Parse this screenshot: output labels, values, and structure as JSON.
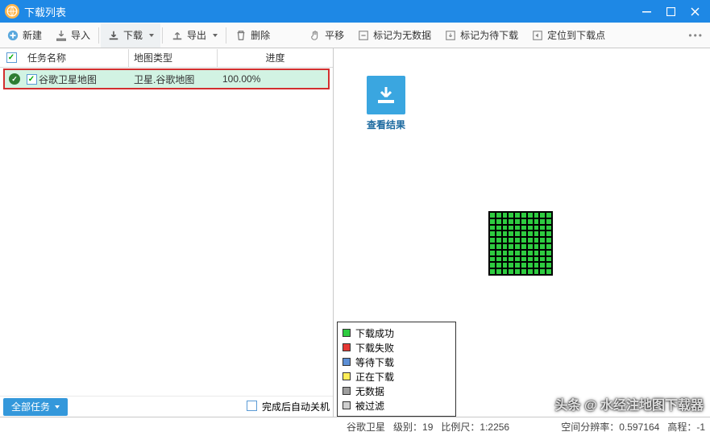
{
  "window": {
    "title": "下载列表"
  },
  "toolbar_left": {
    "new": "新建",
    "import": "导入",
    "download": "下载",
    "export": "导出",
    "delete": "删除"
  },
  "toolbar_right": {
    "pan": "平移",
    "mark_nodata": "标记为无数据",
    "mark_todl": "标记为待下载",
    "locate": "定位到下载点"
  },
  "columns": {
    "name": "任务名称",
    "type": "地图类型",
    "progress": "进度"
  },
  "tasks": [
    {
      "name": "谷歌卫星地图",
      "type": "卫星.谷歌地图",
      "progress": "100.00%"
    }
  ],
  "left_footer": {
    "all_tasks": "全部任务",
    "auto_shutdown": "完成后自动关机"
  },
  "view_result": "查看结果",
  "legend": {
    "success": "下载成功",
    "fail": "下载失败",
    "waiting": "等待下载",
    "downloading": "正在下载",
    "nodata": "无数据",
    "filtered": "被过滤"
  },
  "status": {
    "map": "谷歌卫星",
    "level_label": "级别：",
    "level": "19",
    "scale_label": "比例尺：",
    "scale": "1:2256",
    "res_label": "空间分辨率：",
    "res": "0.597164",
    "elev_label": "高程：",
    "elev": "-1"
  },
  "watermark": "头条 @ 水经注地图下载器"
}
